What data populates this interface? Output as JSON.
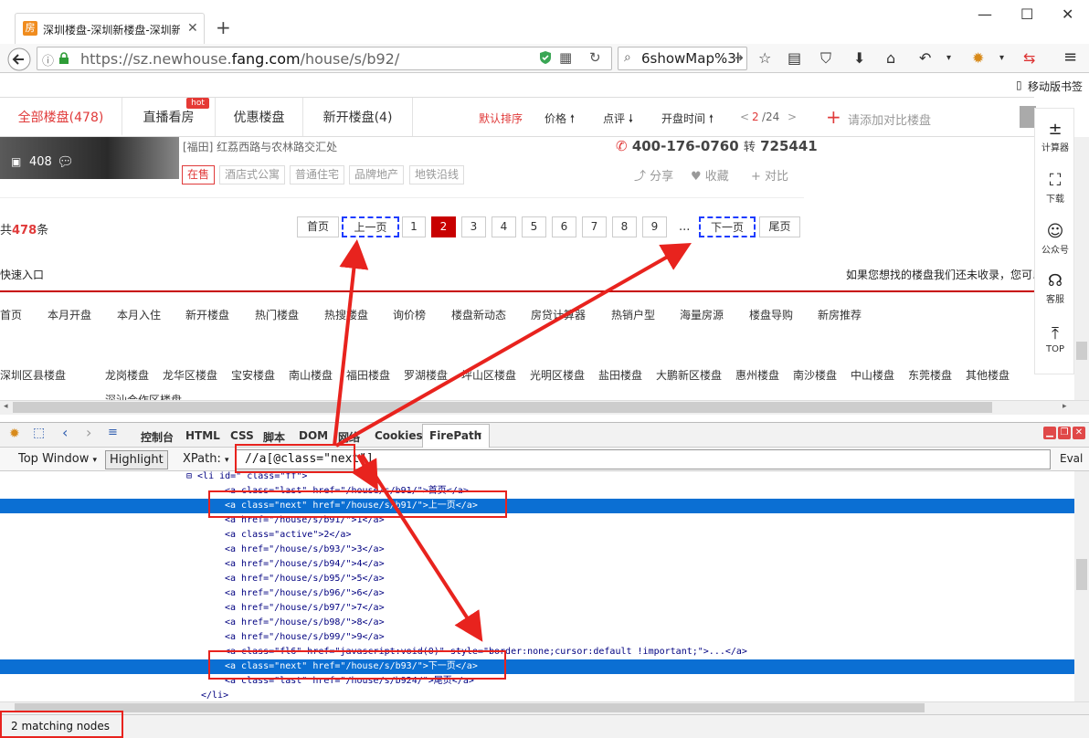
{
  "browser": {
    "tab_title": "深圳楼盘-深圳新楼盘-深圳新",
    "tab_favicon_text": "房",
    "url_prefix": "https://sz.newhouse.",
    "url_domain": "fang.com",
    "url_path": "/house/s/b92/",
    "search_text": "6showMap%3l",
    "mobile_label": "移动版书签"
  },
  "page_nav": {
    "tabs": [
      "全部楼盘(478)",
      "直播看房",
      "优惠楼盘",
      "新开楼盘(4)"
    ],
    "hot_badge": "hot",
    "sort": [
      "默认排序",
      "价格",
      "点评",
      "开盘时间"
    ],
    "page_current": "2",
    "page_total": "/24",
    "add_compare": "请添加对比楼盘"
  },
  "listing": {
    "photo_count": "408",
    "address": "[福田] 红荔西路与农林路交汇处",
    "phone": "400-176-0760",
    "phone_ext_label": "转",
    "phone_ext": "725441",
    "tags": [
      "在售",
      "酒店式公寓",
      "普通住宅",
      "品牌地产",
      "地铁沿线"
    ],
    "share": "分享",
    "favorite": "收藏",
    "compare": "对比"
  },
  "pagination": {
    "total_prefix": "共",
    "total_count": "478",
    "total_suffix": "条",
    "first": "首页",
    "prev": "上一页",
    "pages": [
      "1",
      "2",
      "3",
      "4",
      "5",
      "6",
      "7",
      "8",
      "9"
    ],
    "current": "2",
    "ellipsis": "...",
    "next": "下一页",
    "last": "尾页"
  },
  "footer": {
    "quick_entry": "快速入口",
    "not_found": "如果您想找的楼盘我们还未收录，您可以",
    "quick_links": [
      "首页",
      "本月开盘",
      "本月入住",
      "新开楼盘",
      "热门楼盘",
      "热搜楼盘",
      "询价榜",
      "楼盘新动态",
      "房贷计算器",
      "热销户型",
      "海量房源",
      "楼盘导购",
      "新房推荐"
    ],
    "district_title": "深圳区县楼盘",
    "district_links": [
      "龙岗楼盘",
      "龙华区楼盘",
      "宝安楼盘",
      "南山楼盘",
      "福田楼盘",
      "罗湖楼盘",
      "坪山区楼盘",
      "光明区楼盘",
      "盐田楼盘",
      "大鹏新区楼盘",
      "惠州楼盘",
      "南沙楼盘",
      "中山楼盘",
      "东莞楼盘",
      "其他楼盘"
    ],
    "partial_line": "深汕合作区楼盘"
  },
  "sidebar": [
    {
      "icon": "calculator-icon",
      "label": "计算器"
    },
    {
      "icon": "download-icon",
      "label": "下载"
    },
    {
      "icon": "wechat-icon",
      "label": "公众号"
    },
    {
      "icon": "headset-icon",
      "label": "客服"
    },
    {
      "icon": "top-icon",
      "label": "TOP"
    }
  ],
  "devtools": {
    "tabs": [
      "控制台",
      "HTML",
      "CSS",
      "脚本",
      "DOM",
      "网络",
      "Cookies"
    ],
    "active_tab": "FirePath",
    "top_window": "Top Window",
    "highlight": "Highlight",
    "xpath_label": "XPath:",
    "xpath_value": "//a[@class=\"next\"]",
    "eval": "Eval",
    "status": "2 matching nodes"
  },
  "code_lines": [
    {
      "indent": 204,
      "text": "⊟ <li  id=\"   class=\"ff\">",
      "selected": false
    },
    {
      "indent": 246,
      "text": "<a  class=\"last\"  href=\"/house/s/b91/\">首页</a>",
      "selected": false
    },
    {
      "indent": 246,
      "text": "<a  class=\"next\"  href=\"/house/s/b91/\">上一页</a>",
      "selected": true
    },
    {
      "indent": 246,
      "text": "<a  href=\"/house/s/b91/\">1</a>",
      "selected": false
    },
    {
      "indent": 246,
      "text": "<a  class=\"active\">2</a>",
      "selected": false
    },
    {
      "indent": 246,
      "text": "<a  href=\"/house/s/b93/\">3</a>",
      "selected": false
    },
    {
      "indent": 246,
      "text": "<a  href=\"/house/s/b94/\">4</a>",
      "selected": false
    },
    {
      "indent": 246,
      "text": "<a  href=\"/house/s/b95/\">5</a>",
      "selected": false
    },
    {
      "indent": 246,
      "text": "<a  href=\"/house/s/b96/\">6</a>",
      "selected": false
    },
    {
      "indent": 246,
      "text": "<a  href=\"/house/s/b97/\">7</a>",
      "selected": false
    },
    {
      "indent": 246,
      "text": "<a  href=\"/house/s/b98/\">8</a>",
      "selected": false
    },
    {
      "indent": 246,
      "text": "<a  href=\"/house/s/b99/\">9</a>",
      "selected": false
    },
    {
      "indent": 246,
      "text": "<a  class=\"fl6\"  href=\"javascript:void(0)\"  style=\"border:none;cursor:default !important;\">...</a>",
      "selected": false
    },
    {
      "indent": 246,
      "text": "<a  class=\"next\"  href=\"/house/s/b93/\">下一页</a>",
      "selected": true
    },
    {
      "indent": 246,
      "text": "<a  class=\"last\"  href=\"/house/s/b924/\">尾页</a>",
      "selected": false
    },
    {
      "indent": 220,
      "text": "</li>",
      "selected": false
    }
  ]
}
